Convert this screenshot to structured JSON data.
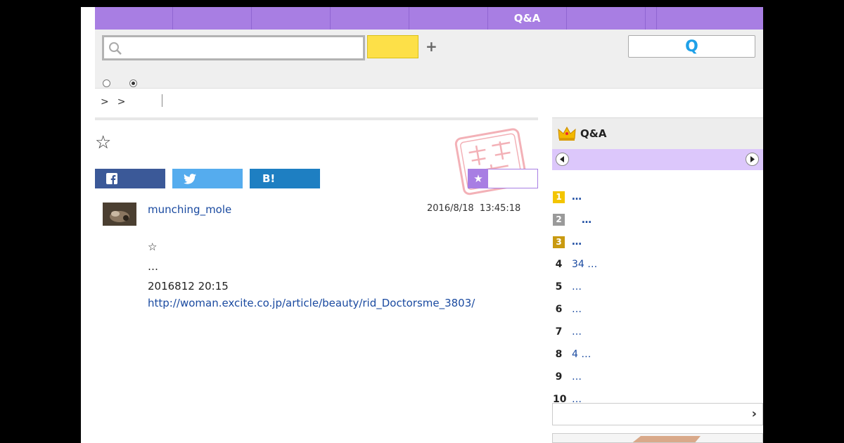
{
  "nav": {
    "items": [
      "",
      "",
      "",
      "",
      "",
      "Q&A",
      "",
      "",
      ""
    ]
  },
  "search": {
    "value": "",
    "placeholder": "",
    "plus_label": "+",
    "submit_label": "Q"
  },
  "breadcrumb": {
    "separators": [
      ">",
      ">"
    ]
  },
  "question": {
    "title_star": "☆"
  },
  "share": {
    "facebook_label": "f",
    "twitter_label": "",
    "hatena_label": "B!"
  },
  "fav": {
    "icon": "★"
  },
  "answer": {
    "username": "munching_mole",
    "date": "2016/8/18  13:45:18",
    "lines": [
      "☆",
      "…",
      "2016812 20:15"
    ],
    "link": "http://woman.excite.co.jp/article/beauty/rid_Doctorsme_3803/"
  },
  "sidebar": {
    "title": "Q&A",
    "ranking": [
      {
        "rank": "1",
        "text": "…",
        "badge_color": "#f3c500"
      },
      {
        "rank": "2",
        "text": "　…",
        "badge_color": "#9a9a9a"
      },
      {
        "rank": "3",
        "text": "…",
        "badge_color": "#c99a10"
      },
      {
        "rank": "4",
        "text": "34  …"
      },
      {
        "rank": "5",
        "text": "…"
      },
      {
        "rank": "6",
        "text": "…"
      },
      {
        "rank": "7",
        "text": "…"
      },
      {
        "rank": "8",
        "text": "4    …"
      },
      {
        "rank": "9",
        "text": "…"
      },
      {
        "rank": "10",
        "text": "…"
      }
    ],
    "more_arrow": "›"
  },
  "colors": {
    "brand_purple": "#a87ee3",
    "facebook": "#3b5998",
    "twitter": "#55acee",
    "hatena": "#1e7fc2",
    "search_yellow": "#fde048",
    "link_blue": "#1a4aa0"
  }
}
